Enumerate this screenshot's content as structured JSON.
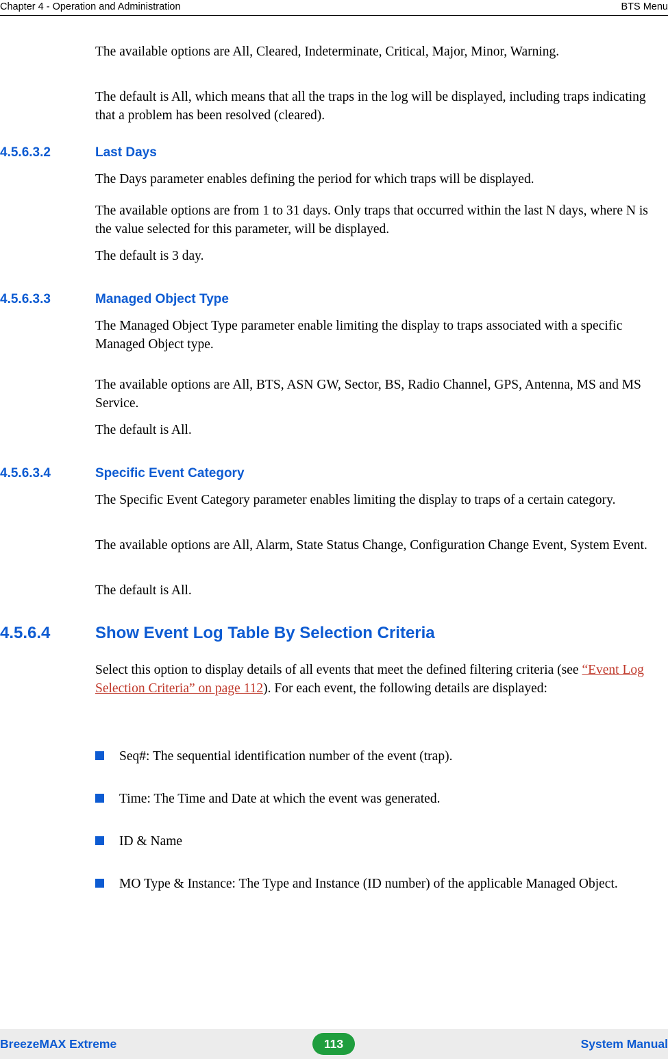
{
  "header": {
    "left": "Chapter 4 - Operation and Administration",
    "right": "BTS Menu"
  },
  "footer": {
    "left": "BreezeMAX Extreme",
    "page_number": "113",
    "right": "System Manual"
  },
  "body": {
    "p1": "The available options are All, Cleared, Indeterminate, Critical, Major, Minor, Warning.",
    "p2": "The default is All, which means that all the traps in the log will be displayed, including traps indicating that a problem has been resolved (cleared).",
    "p3": "The Days parameter enables defining the period for which traps will be displayed.",
    "p4": "The available options are from 1 to 31 days. Only traps that occurred within the last N days, where N is the value selected for this parameter, will be displayed.",
    "p5": "The default is 3 day.",
    "p6": "The Managed Object Type parameter enable limiting the display to traps associated with a specific Managed Object type.",
    "p7": "The available options are All, BTS, ASN GW, Sector, BS, Radio Channel, GPS, Antenna, MS and MS Service.",
    "p8": "The default is All.",
    "p9": "The Specific Event Category parameter enables limiting the display to traps of a certain category.",
    "p10": "The available options are All, Alarm, State Status Change, Configuration Change Event, System Event.",
    "p11": "The default is All.",
    "p12_a": "Select this option to display details of all events that meet the defined filtering criteria (see ",
    "p12_link": "“Event Log Selection Criteria” on page 112",
    "p12_b": "). For each event, the following details are displayed:"
  },
  "headings": {
    "h_last_days": {
      "number": "4.5.6.3.2",
      "title": "Last Days"
    },
    "h_managed_object_type": {
      "number": "4.5.6.3.3",
      "title": "Managed Object Type"
    },
    "h_specific_event_category": {
      "number": "4.5.6.3.4",
      "title": "Specific Event Category"
    },
    "h_show_event_log": {
      "number": "4.5.6.4",
      "title": "Show Event Log Table By Selection Criteria"
    }
  },
  "bullets": [
    "Seq#: The sequential identification number of the event (trap).",
    "Time: The Time and Date at which the event was generated.",
    "ID & Name",
    "MO Type & Instance: The Type and Instance (ID number) of the applicable Managed Object."
  ]
}
